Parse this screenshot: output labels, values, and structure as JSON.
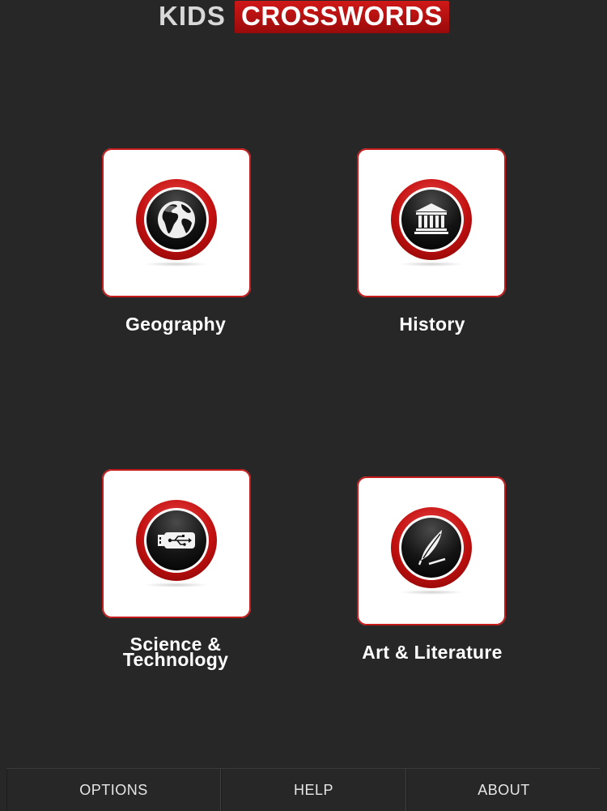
{
  "header": {
    "title_part1": "KIDS",
    "title_part2": "CROSSWORDS"
  },
  "categories": [
    {
      "label": "Geography",
      "icon": "globe-icon"
    },
    {
      "label": "History",
      "icon": "museum-icon"
    },
    {
      "label_line1": "Science &",
      "label_line2": "Technology",
      "icon": "usb-drive-icon"
    },
    {
      "label": "Art & Literature",
      "icon": "quill-pen-icon"
    }
  ],
  "footer": {
    "options_label": "OPTIONS",
    "help_label": "HELP",
    "about_label": "ABOUT"
  },
  "colors": {
    "background": "#272727",
    "accent_red": "#c41a1a",
    "tile": "#ffffff"
  }
}
